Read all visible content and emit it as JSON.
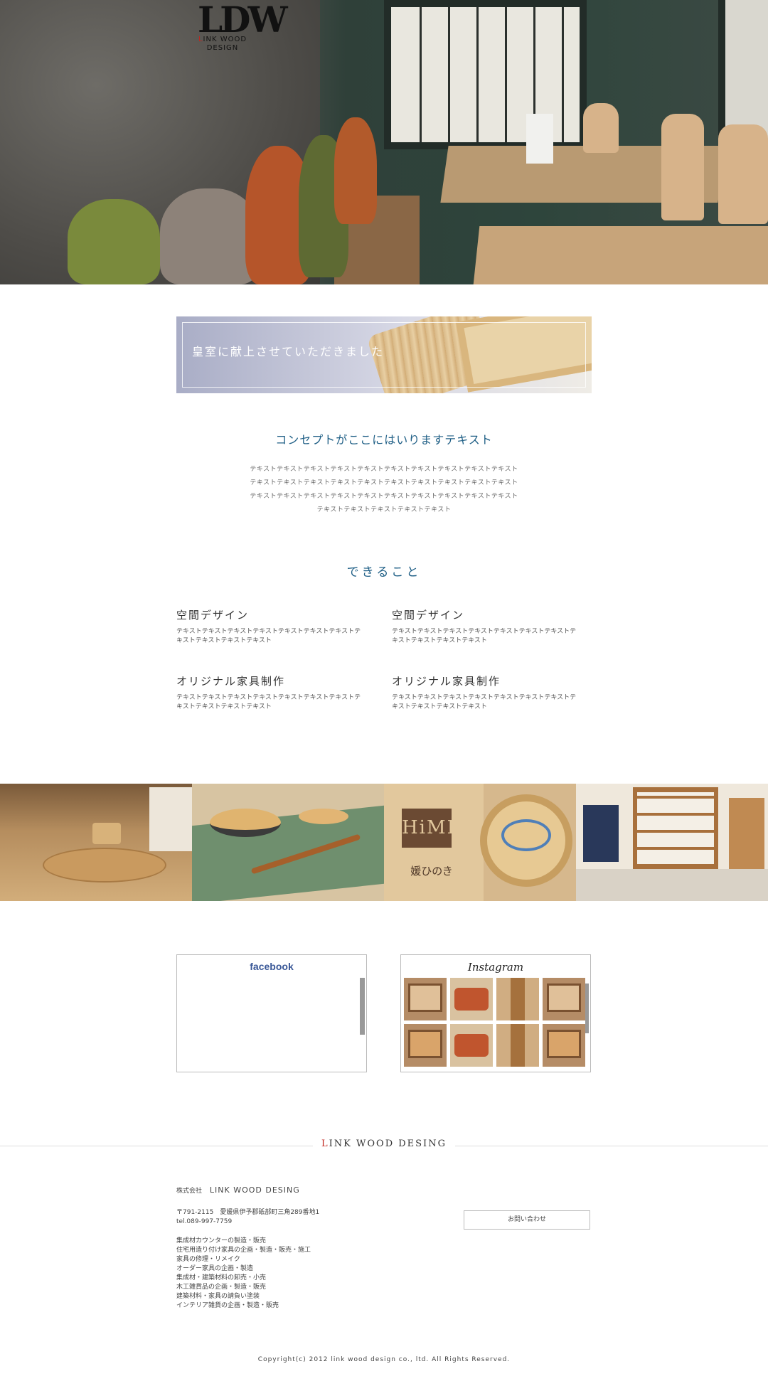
{
  "logo": {
    "mark": "LDW",
    "text_first": "L",
    "text_rest": "INK WOOD",
    "text_line2": "DESIGN"
  },
  "banner": {
    "title": "皇室に献上させていただきました"
  },
  "concept": {
    "title": "コンセプトがここにはいりますテキスト",
    "lines": [
      "テキストテキストテキストテキストテキストテキストテキストテキストテキストテキスト",
      "テキストテキストテキストテキストテキストテキストテキストテキストテキストテキスト",
      "テキストテキストテキストテキストテキストテキストテキストテキストテキストテキスト",
      "テキストテキストテキストテキストテキスト"
    ]
  },
  "services": {
    "title": "できること",
    "items": [
      {
        "title": "空間デザイン",
        "text": "テキストテキストテキストテキストテキストテキストテキストテキストテキストテキストテキスト"
      },
      {
        "title": "空間デザイン",
        "text": "テキストテキストテキストテキストテキストテキストテキストテキストテキストテキストテキスト"
      },
      {
        "title": "オリジナル家具制作",
        "text": "テキストテキストテキストテキストテキストテキストテキストテキストテキストテキストテキスト"
      },
      {
        "title": "オリジナル家具制作",
        "text": "テキストテキストテキストテキストテキストテキストテキストテキストテキストテキストテキスト"
      }
    ]
  },
  "photo_sign": {
    "letters": "HiME",
    "caption": "媛ひのき"
  },
  "social": {
    "facebook_label": "facebook",
    "instagram_label": "Instagram"
  },
  "footer": {
    "brand_first": "L",
    "brand_rest": "INK WOOD DESING",
    "company_prefix": "株式会社",
    "company_name": "LINK WOOD DESING",
    "address": "〒791-2115　愛媛県伊予郡砥部町三角289番地1",
    "tel": "tel.089-997-7759",
    "business": [
      "集成材カウンターの製造・販売",
      "住宅用造り付け家具の企画・製造・販売・施工",
      "家具の修理・リメイク",
      "オーダー家具の企画・製造",
      "集成材・建築材料の卸売・小売",
      "木工雑貨品の企画・製造・販売",
      "建築材料・家具の請負い塗装",
      "インテリア雑貨の企画・製造・販売"
    ],
    "contact_label": "お問い合わせ",
    "copyright": "Copyright(c) 2012 link wood design co., ltd. All Rights Reserved."
  }
}
